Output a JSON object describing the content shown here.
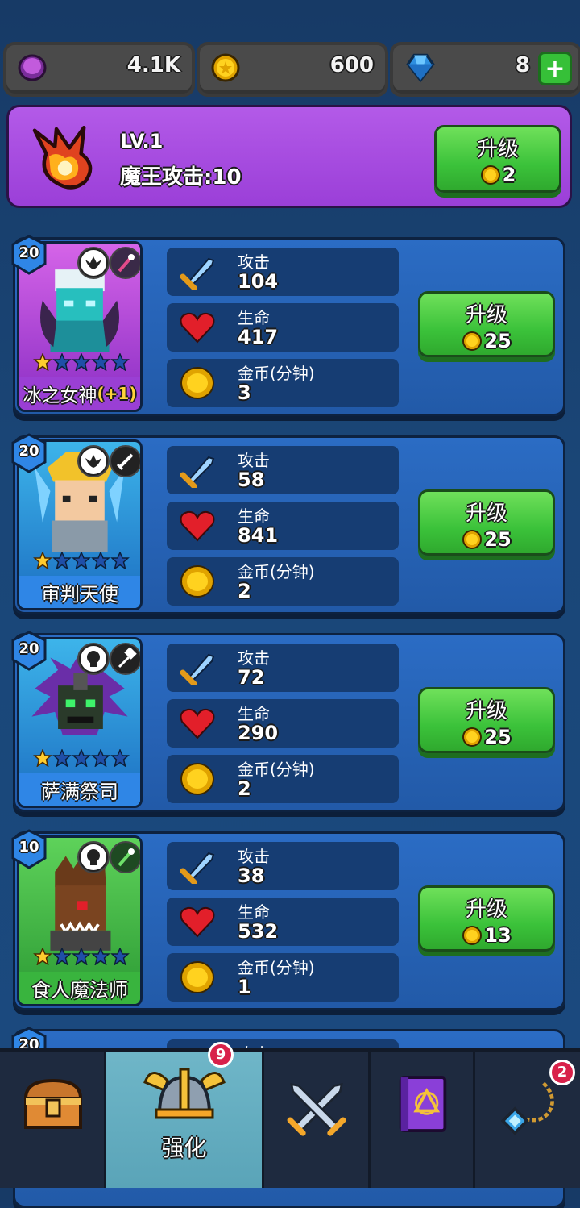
{
  "resources": {
    "purple_coins": "4.1K",
    "gold_coins": "600",
    "gems": "8",
    "add_gems_label": "+"
  },
  "boss": {
    "level": "LV.1",
    "attack_text": "魔王攻击:10",
    "upgrade_label": "升级",
    "upgrade_cost": "2"
  },
  "heroes": [
    {
      "level": "20",
      "name": "冰之女神",
      "name_bonus": "(+1)",
      "stars_filled": 1,
      "stars_total": 5,
      "attack_label": "攻击",
      "attack": "104",
      "hp_label": "生命",
      "hp": "417",
      "gold_label": "金币(分钟)",
      "gold": "3",
      "upgrade_label": "升级",
      "upgrade_cost": "25"
    },
    {
      "level": "20",
      "name": "审判天使",
      "stars_filled": 1,
      "stars_total": 5,
      "attack_label": "攻击",
      "attack": "58",
      "hp_label": "生命",
      "hp": "841",
      "gold_label": "金币(分钟)",
      "gold": "2",
      "upgrade_label": "升级",
      "upgrade_cost": "25"
    },
    {
      "level": "20",
      "name": "萨满祭司",
      "stars_filled": 1,
      "stars_total": 5,
      "attack_label": "攻击",
      "attack": "72",
      "hp_label": "生命",
      "hp": "290",
      "gold_label": "金币(分钟)",
      "gold": "2",
      "upgrade_label": "升级",
      "upgrade_cost": "25"
    },
    {
      "level": "10",
      "name": "食人魔法师",
      "stars_filled": 1,
      "stars_total": 5,
      "attack_label": "攻击",
      "attack": "38",
      "hp_label": "生命",
      "hp": "532",
      "gold_label": "金币(分钟)",
      "gold": "1",
      "upgrade_label": "升级",
      "upgrade_cost": "13"
    },
    {
      "level": "20",
      "attack_label": "攻击"
    }
  ],
  "nav": {
    "tabs": [
      {
        "icon": "treasure-chest-icon"
      },
      {
        "icon": "viking-helmet-icon",
        "label": "强化",
        "badge": "9",
        "active": true
      },
      {
        "icon": "crossed-swords-icon"
      },
      {
        "icon": "spell-book-icon"
      },
      {
        "icon": "amulet-icon",
        "badge": "2"
      }
    ]
  },
  "colors": {
    "background": "#1a4677",
    "boss_banner": "#a34bdf",
    "upgrade_button": "#3bc23a",
    "hero_card": "#2660b4",
    "stat_bg": "#163d73",
    "active_tab": "#63adc0",
    "badge": "#d8214a"
  }
}
